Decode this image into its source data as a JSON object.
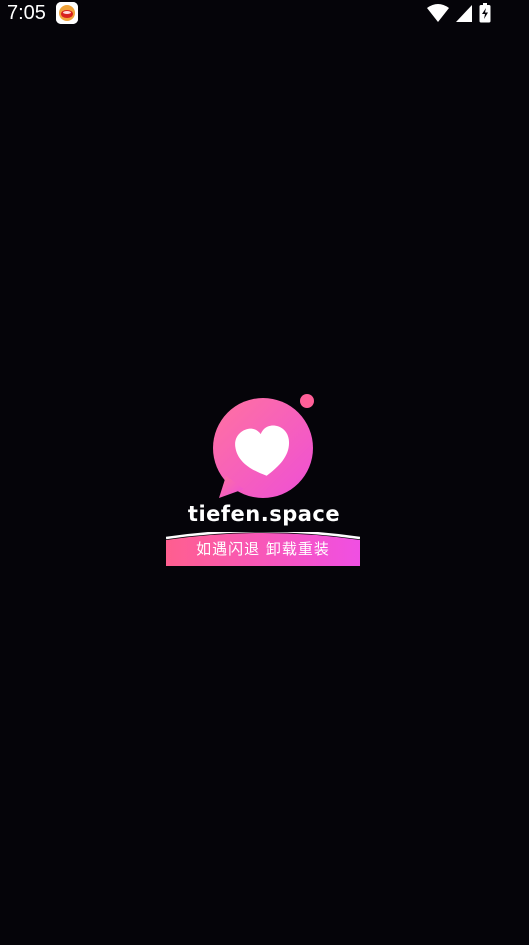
{
  "status_bar": {
    "time": "7:05",
    "notification_icon": "app-notification-icon",
    "wifi_icon": "wifi-icon",
    "signal_icon": "cell-signal-icon",
    "battery_icon": "battery-charging-icon"
  },
  "splash": {
    "logo_icon": "heart-chat-bubble-logo",
    "domain": "tiefen.space",
    "notice": "如遇闪退 卸载重装"
  },
  "colors": {
    "background": "#050409",
    "logo_gradient_start": "#ff6fa6",
    "logo_gradient_end": "#ee4fd6",
    "banner_gradient_start": "#ff5f8f",
    "banner_gradient_end": "#f04fe3"
  }
}
